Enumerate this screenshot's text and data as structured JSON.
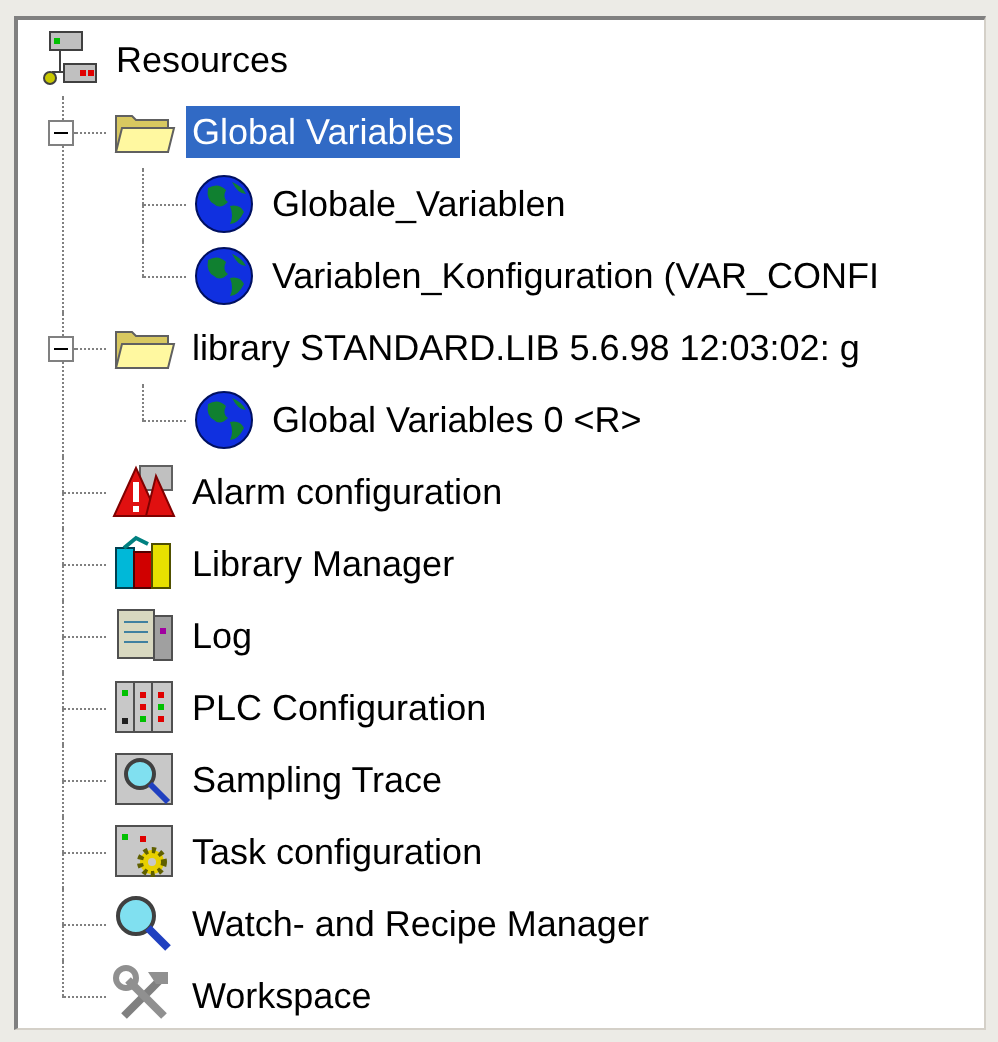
{
  "tree": {
    "label": "Resources",
    "kind": "resources",
    "selected": false,
    "children": [
      {
        "label": "Global Variables",
        "kind": "folder",
        "selected": true,
        "expanded": true,
        "children": [
          {
            "label": "Globale_Variablen",
            "kind": "globe",
            "selected": false
          },
          {
            "label": "Variablen_Konfiguration (VAR_CONFI",
            "kind": "globe",
            "selected": false
          }
        ]
      },
      {
        "label": "library STANDARD.LIB 5.6.98 12:03:02: g",
        "kind": "folder",
        "selected": false,
        "expanded": true,
        "children": [
          {
            "label": "Global Variables 0 <R>",
            "kind": "globe",
            "selected": false
          }
        ]
      },
      {
        "label": "Alarm configuration",
        "kind": "alarm",
        "selected": false
      },
      {
        "label": "Library Manager",
        "kind": "books",
        "selected": false
      },
      {
        "label": "Log",
        "kind": "log",
        "selected": false
      },
      {
        "label": "PLC Configuration",
        "kind": "plc",
        "selected": false
      },
      {
        "label": "Sampling Trace",
        "kind": "trace",
        "selected": false
      },
      {
        "label": "Task configuration",
        "kind": "task",
        "selected": false
      },
      {
        "label": "Watch- and Recipe Manager",
        "kind": "watch",
        "selected": false
      },
      {
        "label": "Workspace",
        "kind": "tools",
        "selected": false
      }
    ]
  }
}
